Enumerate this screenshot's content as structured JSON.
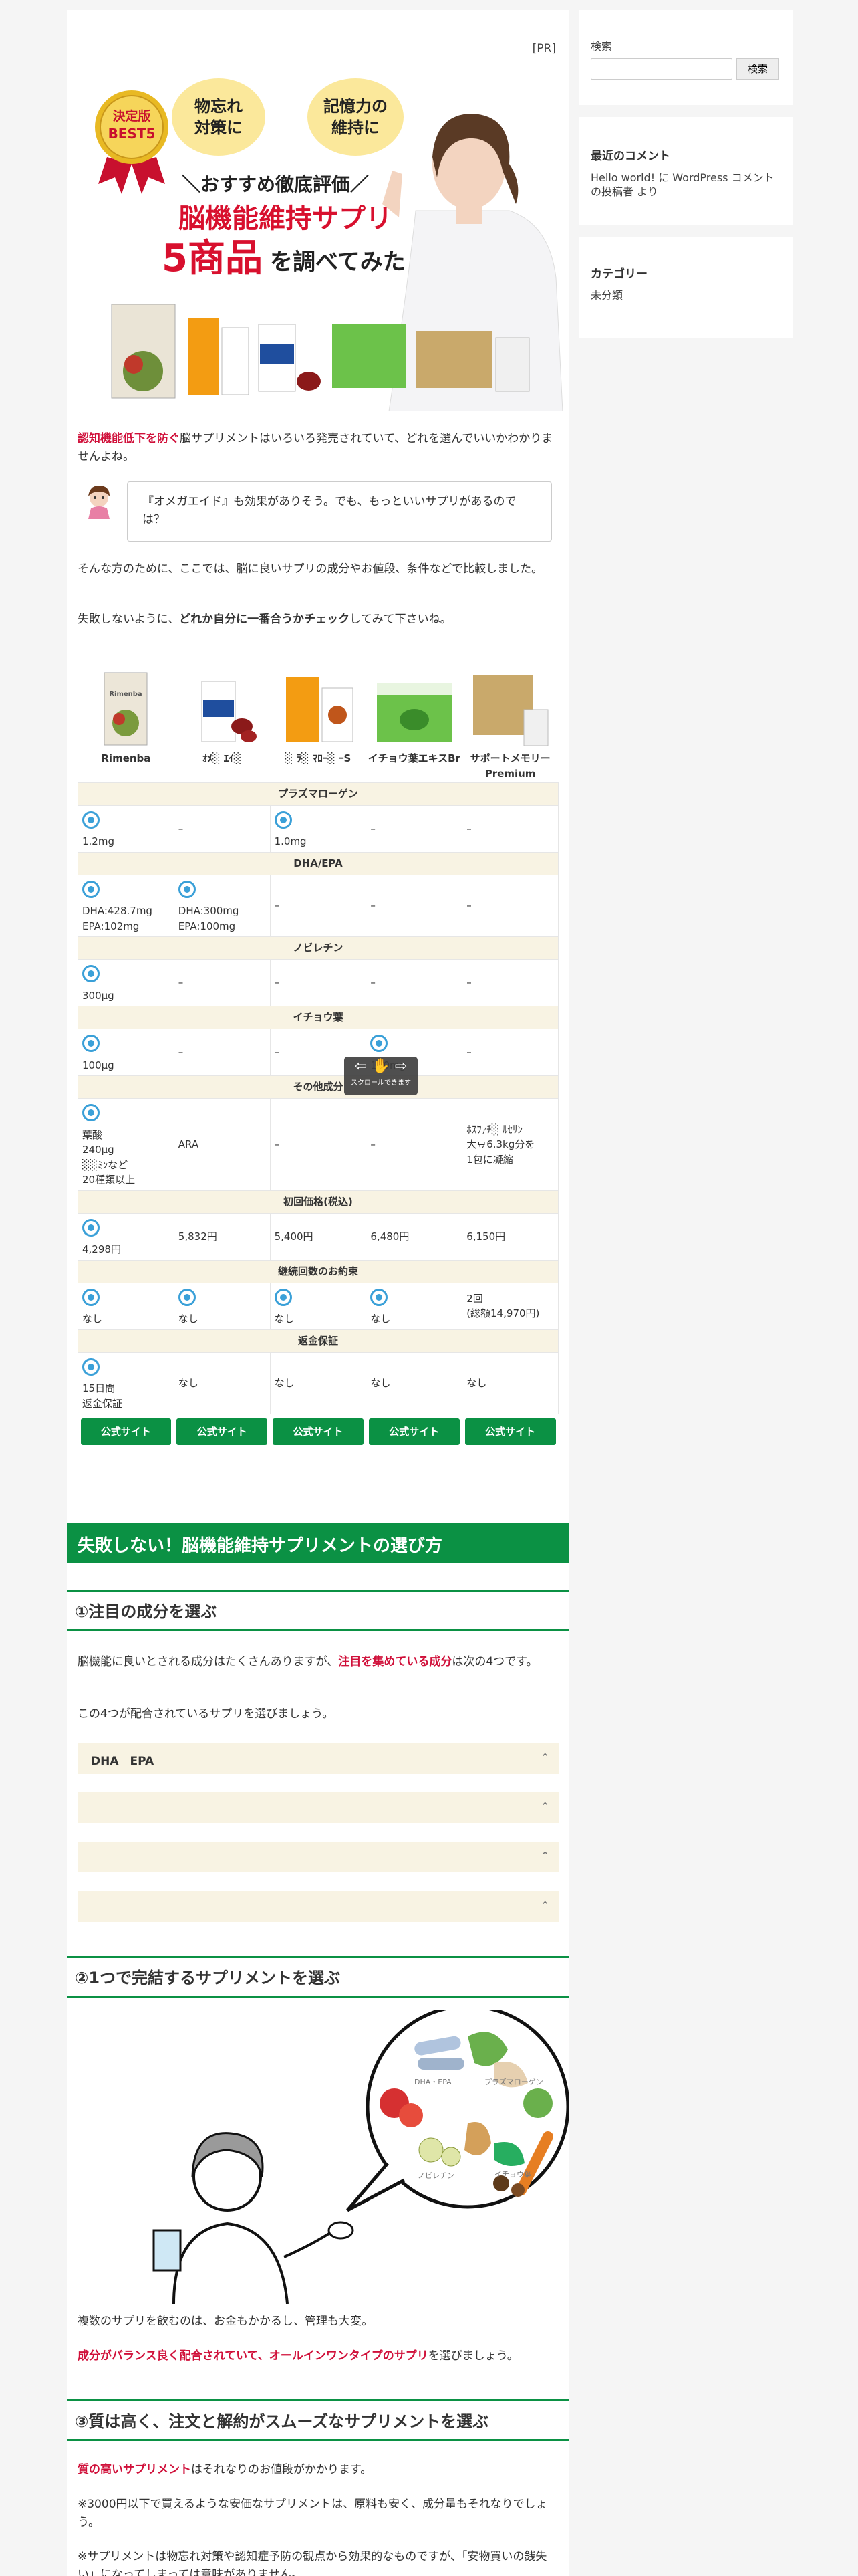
{
  "pr": "[PR]",
  "hero": {
    "badge_top": "決定版",
    "badge_bottom": "BEST5",
    "bubble1_l1": "物忘れ",
    "bubble1_l2": "対策に",
    "bubble2_l1": "記憶力の",
    "bubble2_l2": "維持に",
    "sub": "＼おすすめ徹底評価／",
    "title": "脳機能維持サプリ",
    "num": "5商品",
    "tail": "を調べてみた"
  },
  "intro": {
    "red": "認知機能低下を防ぐ",
    "rest": "脳サプリメントはいろいろ発売されていて、どれを選んでいいかわかりませんよね。"
  },
  "bubble_text": "『オメガエイド』も効果がありそう。でも、もっといいサプリがあるのでは？",
  "para1": "そんな方のために、ここでは、脳に良いサプリの成分やお値段、条件などで比較しました。",
  "para2": {
    "a": "失敗しないように、",
    "b": "どれか自分に一番合うかチェック",
    "c": "してみて下さいね。"
  },
  "products": [
    "Rimenba",
    "ｵﾒ░ ｴｲ░",
    "░ ﾗ░ ﾏﾛｰ░ ｰS",
    "イチョウ葉エキスBr",
    "サポートメモリーPremium"
  ],
  "sections": [
    {
      "header": "プラズマローゲン",
      "cells": [
        {
          "circle": true,
          "text": "1.2mg"
        },
        {
          "circle": false,
          "text": "–"
        },
        {
          "circle": true,
          "text": "1.0mg"
        },
        {
          "circle": false,
          "text": "–"
        },
        {
          "circle": false,
          "text": "–"
        }
      ]
    },
    {
      "header": "DHA/EPA",
      "cells": [
        {
          "circle": true,
          "text": "DHA:428.7mg\nEPA:102mg"
        },
        {
          "circle": true,
          "text": "DHA:300mg\nEPA:100mg"
        },
        {
          "circle": false,
          "text": "–"
        },
        {
          "circle": false,
          "text": "–"
        },
        {
          "circle": false,
          "text": "–"
        }
      ]
    },
    {
      "header": "ノビレチン",
      "cells": [
        {
          "circle": true,
          "text": "300μg"
        },
        {
          "circle": false,
          "text": "–"
        },
        {
          "circle": false,
          "text": "–"
        },
        {
          "circle": false,
          "text": "–"
        },
        {
          "circle": false,
          "text": "–"
        }
      ]
    },
    {
      "header": "イチョウ葉",
      "cells": [
        {
          "circle": true,
          "text": "100μg"
        },
        {
          "circle": false,
          "text": "–"
        },
        {
          "circle": false,
          "text": "–"
        },
        {
          "circle": true,
          "text": "120mg"
        },
        {
          "circle": false,
          "text": "–"
        }
      ]
    },
    {
      "header": "その他成分",
      "cells": [
        {
          "circle": true,
          "text": "葉酸\n240μg\n░░ﾐﾝなど\n20種類以上"
        },
        {
          "circle": false,
          "text": "ARA"
        },
        {
          "circle": false,
          "text": "–"
        },
        {
          "circle": false,
          "text": "–"
        },
        {
          "circle": false,
          "text": "ﾎｽﾌｧﾁ░ ﾙｾﾘﾝ\n大豆6.3kg分を\n1包に凝縮"
        }
      ]
    },
    {
      "header": "初回価格(税込)",
      "cells": [
        {
          "circle": true,
          "text": "4,298円"
        },
        {
          "circle": false,
          "text": "5,832円"
        },
        {
          "circle": false,
          "text": "5,400円"
        },
        {
          "circle": false,
          "text": "6,480円"
        },
        {
          "circle": false,
          "text": "6,150円"
        }
      ]
    },
    {
      "header": "継続回数のお約束",
      "cells": [
        {
          "circle": true,
          "text": "なし"
        },
        {
          "circle": true,
          "text": "なし"
        },
        {
          "circle": true,
          "text": "なし"
        },
        {
          "circle": true,
          "text": "なし"
        },
        {
          "circle": false,
          "text": "2回\n(総額14,970円)"
        }
      ]
    },
    {
      "header": "返金保証",
      "cells": [
        {
          "circle": true,
          "text": "15日間\n返金保証"
        },
        {
          "circle": false,
          "text": "なし"
        },
        {
          "circle": false,
          "text": "なし"
        },
        {
          "circle": false,
          "text": "なし"
        },
        {
          "circle": false,
          "text": "なし"
        }
      ]
    }
  ],
  "official_button": "公式サイト",
  "scroll_hint": "スクロールできます",
  "h2": "失敗しない！脳機能維持サプリメントの選び方",
  "s1": {
    "title": "①注目の成分を選ぶ",
    "p1a": "脳機能に良いとされる成分はたくさんありますが、",
    "p1red": "注目を集めている成分",
    "p1b": "は次の4つです。",
    "p2": "この4つが配合されているサプリを選びましょう。",
    "acc": [
      "DHA　EPA",
      "",
      "",
      ""
    ],
    "chev": "⌃"
  },
  "s2": {
    "title": "②1つで完結するサプリメントを選ぶ",
    "labels": [
      "DHA・EPA",
      "プラズマローゲン",
      "ノビレチン",
      "イチョウ葉"
    ],
    "p1": "複数のサプリを飲むのは、お金もかかるし、管理も大変。",
    "p2red": "成分がバランス良く配合されていて、オールインワンタイプのサプリ",
    "p2b": "を選びましょう。"
  },
  "s3": {
    "title": "③質は高く、注文と解約がスムーズなサプリメントを選ぶ",
    "p1red": "質の高いサプリメント",
    "p1b": "はそれなりのお値段がかかります。",
    "p2": "※3000円以下で買えるような安価なサプリメントは、原料も安く、成分量もそれなりでしょう。",
    "p3": "※サプリメントは物忘れ対策や認知症予防の観点から効果的なものですが、「安物買いの銭失い」になってしまっては意味がありません。"
  },
  "sidebar": {
    "search_label": "検索",
    "search_button": "検索",
    "recent_title": "最近のコメント",
    "recent_text": "Hello world! に WordPress コメントの投稿者 より",
    "cat_title": "カテゴリー",
    "cat_item": "未分類"
  }
}
